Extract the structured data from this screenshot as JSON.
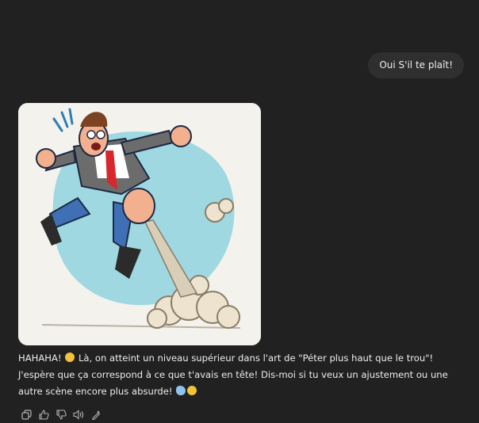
{
  "user_message": {
    "text": "Oui S'il te plaît!"
  },
  "assistant_message": {
    "part1": "HAHAHA! ",
    "emoji1": "laughing-emoji",
    "part2": " Là, on atteint un niveau supérieur dans l'art de \"Péter plus haut que le trou\"! J'espère que ça correspond à ce que t'avais en tête! Dis-moi si tu veux un ajustement ou une autre scène encore plus absurde! ",
    "emoji2": "wind-emoji",
    "emoji3": "rolling-laughing-emoji"
  },
  "actions": [
    {
      "icon": "copy-icon"
    },
    {
      "icon": "thumbs-up-icon"
    },
    {
      "icon": "thumbs-down-icon"
    },
    {
      "icon": "read-aloud-icon"
    },
    {
      "icon": "edit-image-icon"
    }
  ],
  "colors": {
    "background": "#212121",
    "user_bubble": "#2f2f2f",
    "text": "#ececec",
    "icon": "#b4b4b4"
  }
}
